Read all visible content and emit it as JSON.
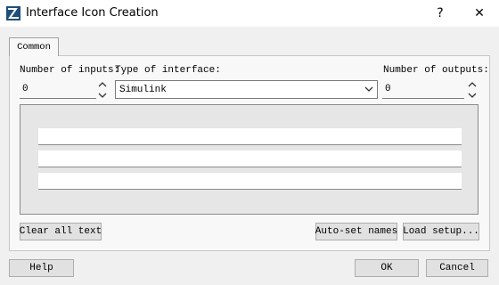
{
  "window": {
    "title": "Interface Icon Creation",
    "help_glyph": "?",
    "close_glyph": "✕"
  },
  "tabs": [
    {
      "label": "Common"
    }
  ],
  "form": {
    "inputs_label": "Number of inputs:",
    "inputs_value": "0",
    "type_label": "Type of interface:",
    "type_value": "Simulink",
    "outputs_label": "Number of outputs:",
    "outputs_value": "0"
  },
  "name_fields": [
    "",
    "",
    ""
  ],
  "buttons": {
    "clear_all_text": "Clear all text",
    "auto_set_names": "Auto-set names",
    "load_setup": "Load setup...",
    "help": "Help",
    "ok": "OK",
    "cancel": "Cancel"
  },
  "colors": {
    "icon_blue": "#1f4e79",
    "title_bg": "#ffffff",
    "dialog_bg": "#f0f0f0",
    "button_bg": "#e1e1e1"
  },
  "icons": [
    "app-logo",
    "chevron-up",
    "chevron-down",
    "dropdown-chevron"
  ]
}
